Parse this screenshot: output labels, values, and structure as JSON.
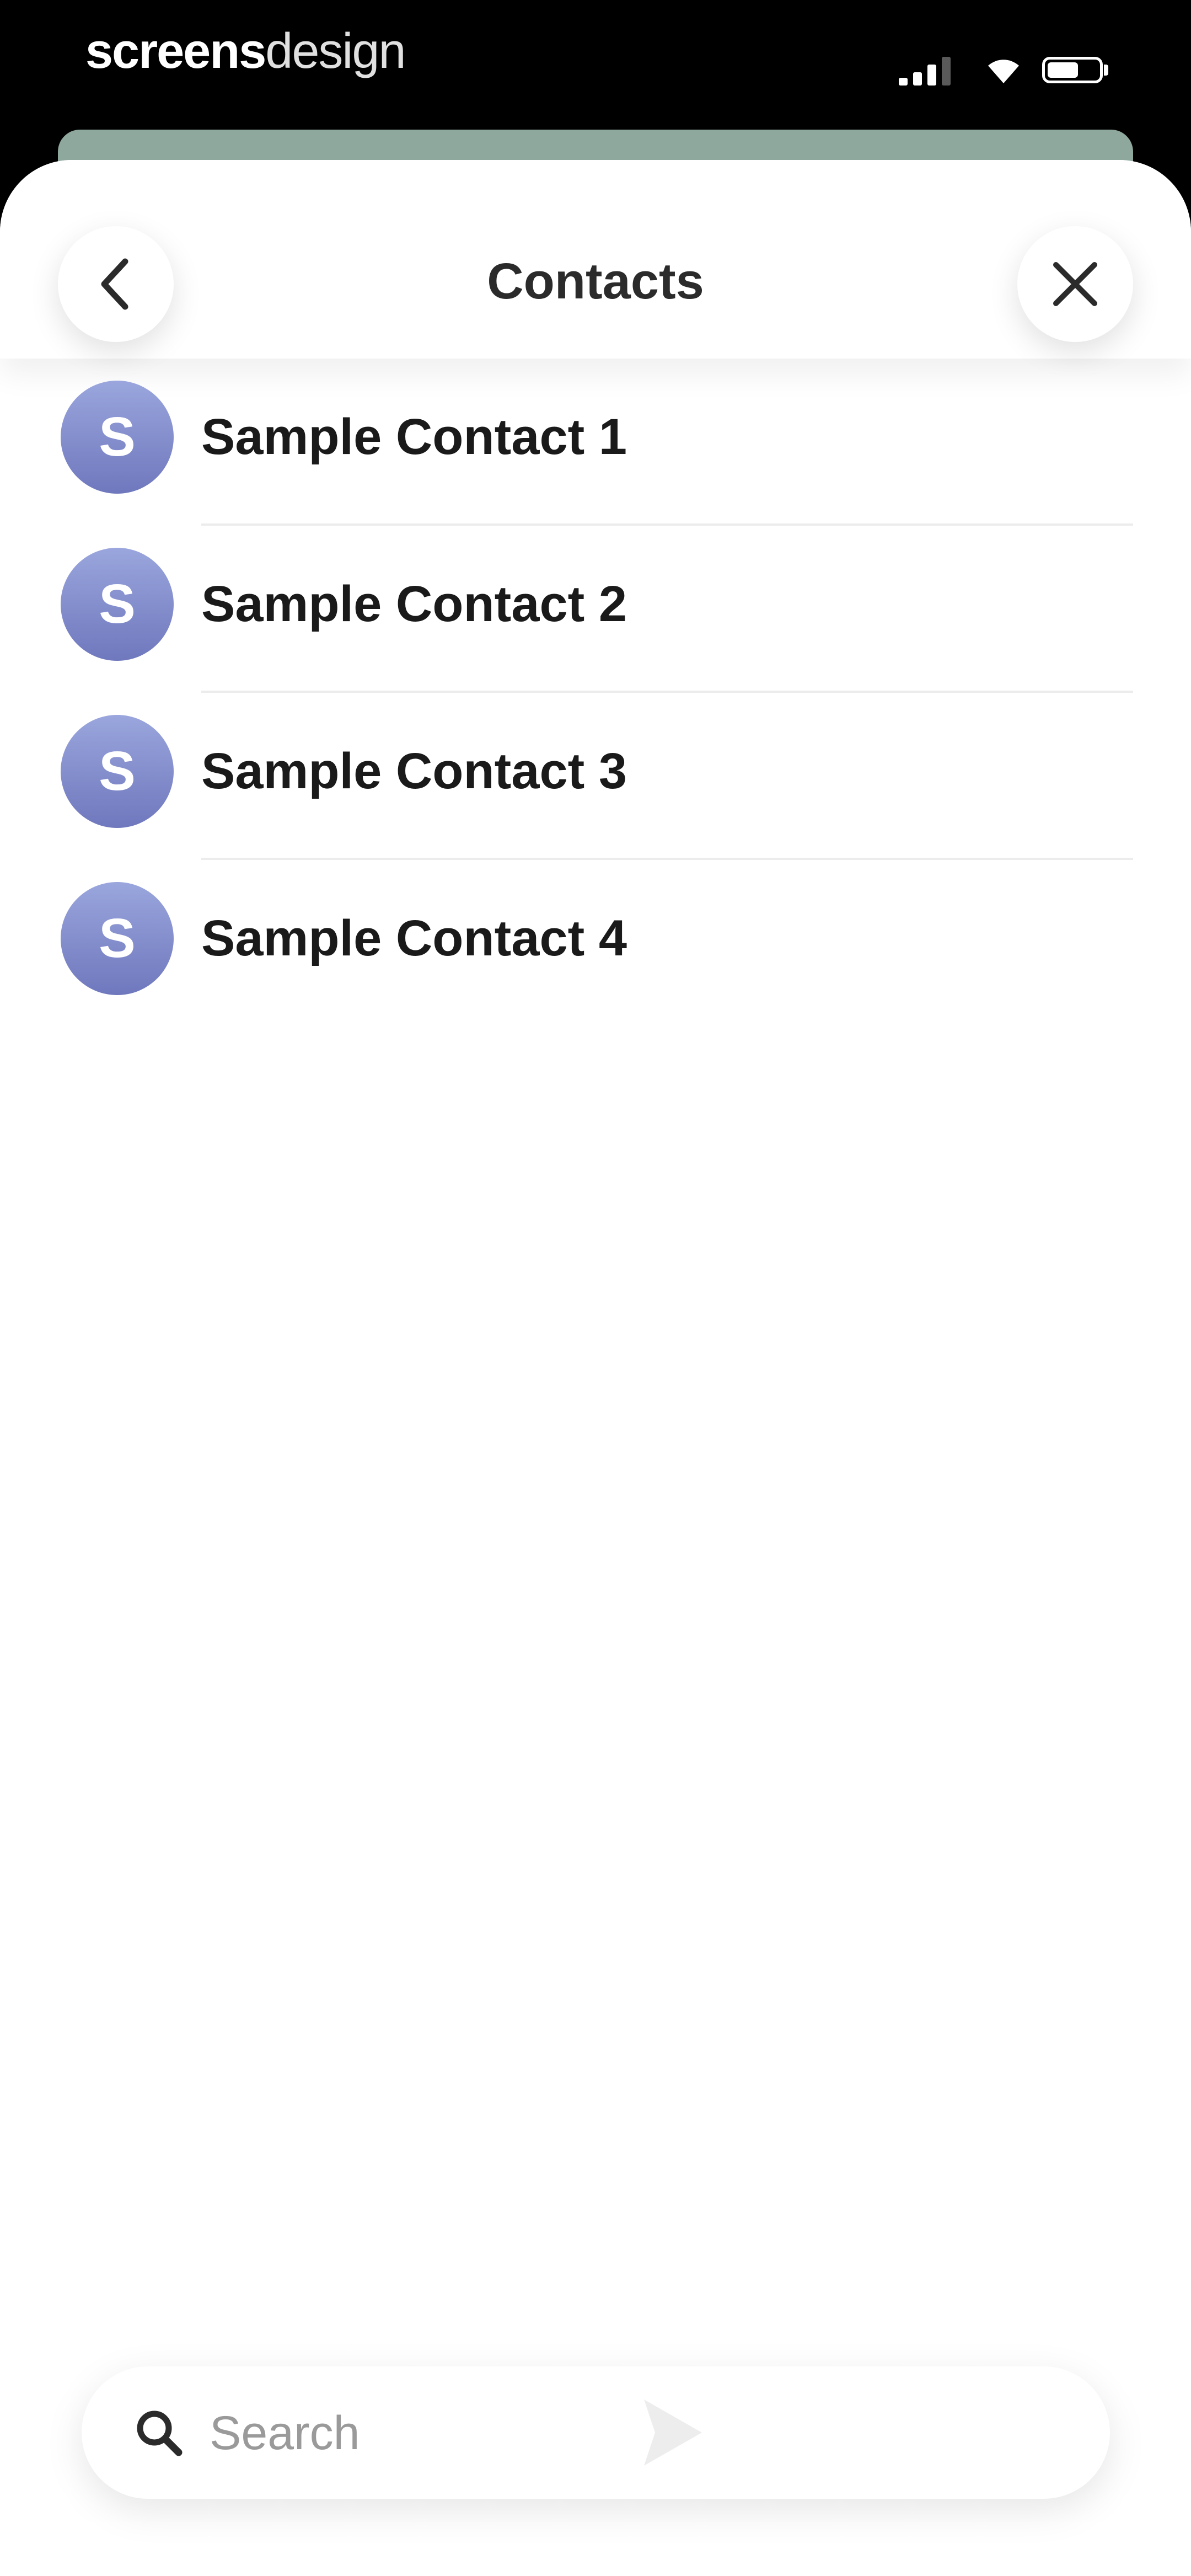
{
  "status_bar": {
    "brand_bold": "screens",
    "brand_light": "design"
  },
  "header": {
    "title": "Contacts",
    "back_icon": "chevron-left-icon",
    "close_icon": "close-icon"
  },
  "contacts": [
    {
      "initial": "S",
      "name": "Sample Contact 1"
    },
    {
      "initial": "S",
      "name": "Sample Contact 2"
    },
    {
      "initial": "S",
      "name": "Sample Contact 3"
    },
    {
      "initial": "S",
      "name": "Sample Contact 4"
    }
  ],
  "search": {
    "placeholder": "Search",
    "value": ""
  },
  "colors": {
    "avatar_top": "#9aa6dd",
    "avatar_bottom": "#6f78bd",
    "sheet_peek": "#8fa89e"
  }
}
